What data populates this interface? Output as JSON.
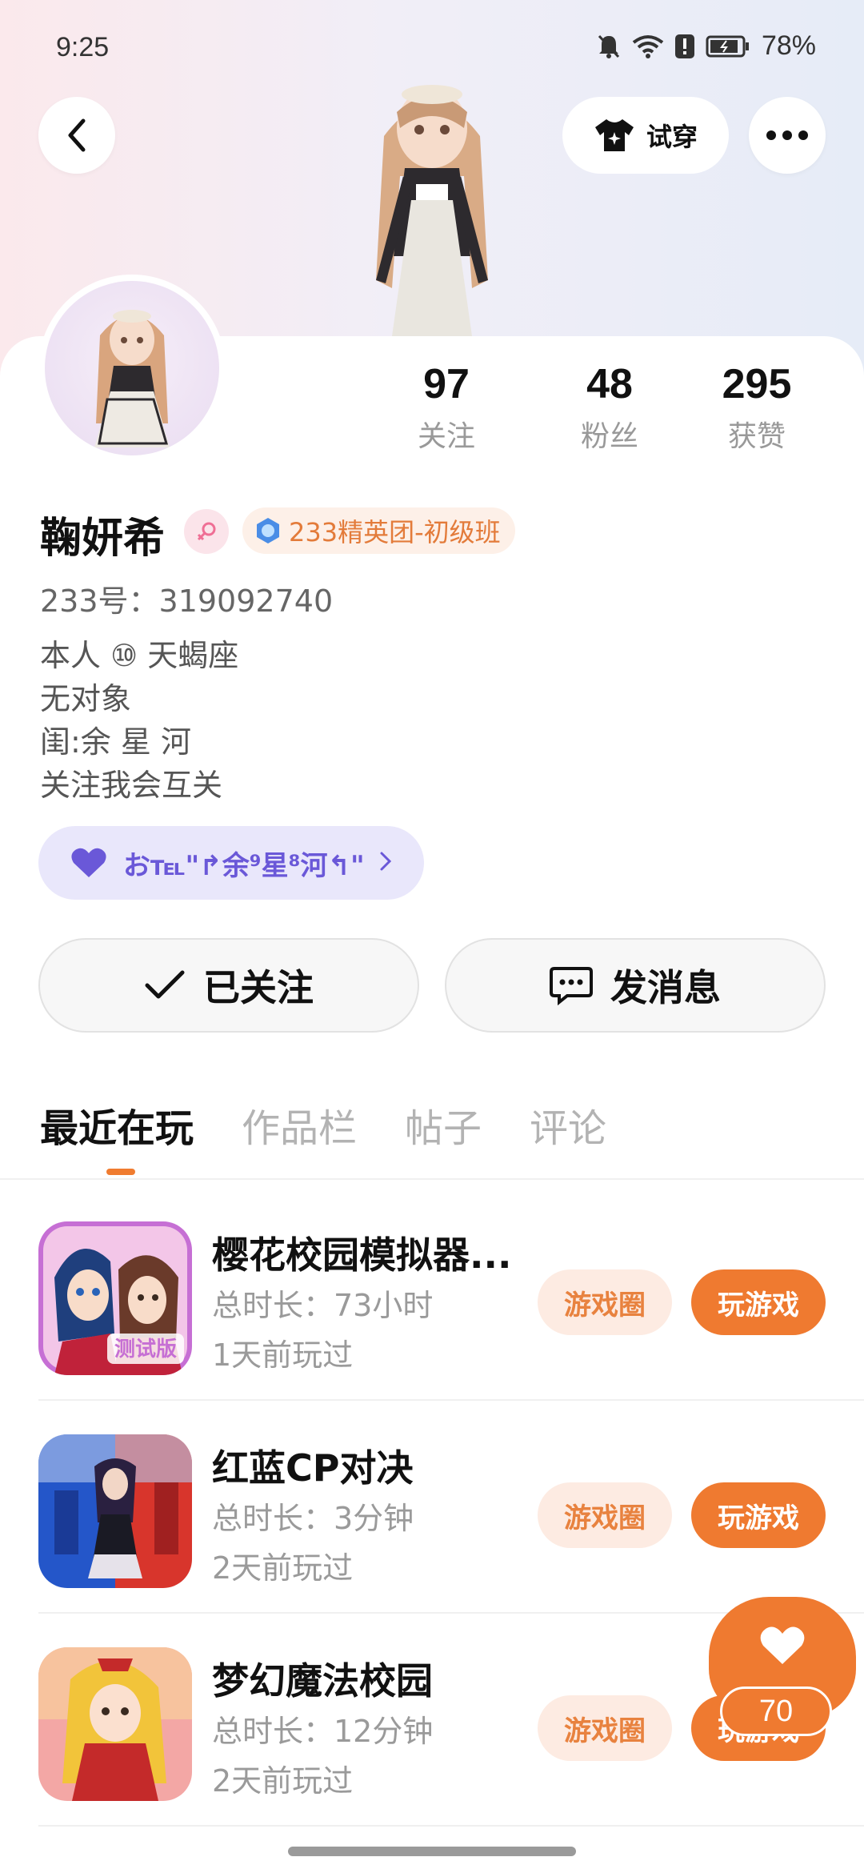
{
  "status_bar": {
    "time": "9:25",
    "battery": "78%"
  },
  "header": {
    "try_on_label": "试穿"
  },
  "profile": {
    "name": "鞠妍希",
    "club_badge": "233精英团-初级班",
    "uid": "233号：319092740",
    "bio": [
      "本人 ⑩ 天蝎座",
      "无对象",
      "闺:余 星 河",
      "关注我会互关"
    ],
    "tag_text": "お℡\"↱余⁹星⁸河↰\"",
    "stats": [
      {
        "value": "97",
        "label": "关注"
      },
      {
        "value": "48",
        "label": "粉丝"
      },
      {
        "value": "295",
        "label": "获赞"
      }
    ]
  },
  "actions": {
    "followed_label": "已关注",
    "message_label": "发消息"
  },
  "tabs": [
    "最近在玩",
    "作品栏",
    "帖子",
    "评论"
  ],
  "games": [
    {
      "title": "樱花校园模拟器...",
      "duration": "总时长：73小时",
      "last_played": "1天前玩过",
      "circle_label": "游戏圈",
      "play_label": "玩游戏",
      "icon_badge": "测试版"
    },
    {
      "title": "红蓝CP对决",
      "duration": "总时长：3分钟",
      "last_played": "2天前玩过",
      "circle_label": "游戏圈",
      "play_label": "玩游戏"
    },
    {
      "title": "梦幻魔法校园",
      "duration": "总时长：12分钟",
      "last_played": "2天前玩过",
      "circle_label": "游戏圈",
      "play_label": "玩游戏"
    }
  ],
  "fab": {
    "count": "70"
  },
  "colors": {
    "accent": "#ef7a30",
    "accent_light": "#fdebe2",
    "tag_bg": "#e9e7fb",
    "tag_text": "#6a58d8"
  }
}
